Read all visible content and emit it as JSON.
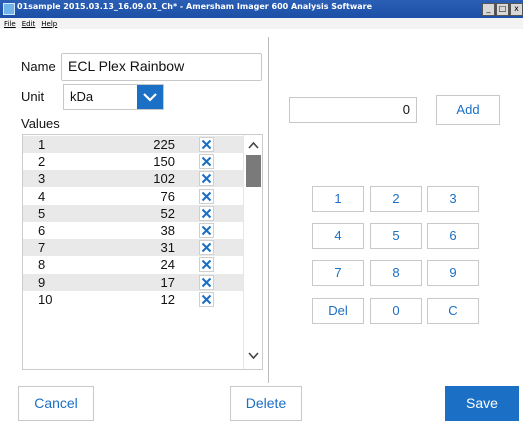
{
  "window": {
    "title": "01sample 2015.03.13_16.09.01_Ch* - Amersham Imager 600 Analysis Software",
    "min_glyph": "_",
    "max_glyph": "□",
    "close_glyph": "x"
  },
  "menu": {
    "items": [
      "File",
      "Edit",
      "Help"
    ]
  },
  "form": {
    "name_label": "Name",
    "name_value": "ECL Plex Rainbow",
    "unit_label": "Unit",
    "unit_value": "kDa",
    "values_label": "Values"
  },
  "values": [
    {
      "index": "1",
      "value": "225"
    },
    {
      "index": "2",
      "value": "150"
    },
    {
      "index": "3",
      "value": "102"
    },
    {
      "index": "4",
      "value": "76"
    },
    {
      "index": "5",
      "value": "52"
    },
    {
      "index": "6",
      "value": "38"
    },
    {
      "index": "7",
      "value": "31"
    },
    {
      "index": "8",
      "value": "24"
    },
    {
      "index": "9",
      "value": "17"
    },
    {
      "index": "10",
      "value": "12"
    }
  ],
  "keypad": {
    "display": "0",
    "add_label": "Add",
    "keys": [
      "1",
      "2",
      "3",
      "4",
      "5",
      "6",
      "7",
      "8",
      "9",
      "Del",
      "0",
      "C"
    ]
  },
  "footer": {
    "cancel": "Cancel",
    "delete": "Delete",
    "save": "Save"
  },
  "colors": {
    "accent": "#1b6fc4",
    "titlebar": "#1c4fa6",
    "row_stripe": "#e9e9e9"
  }
}
